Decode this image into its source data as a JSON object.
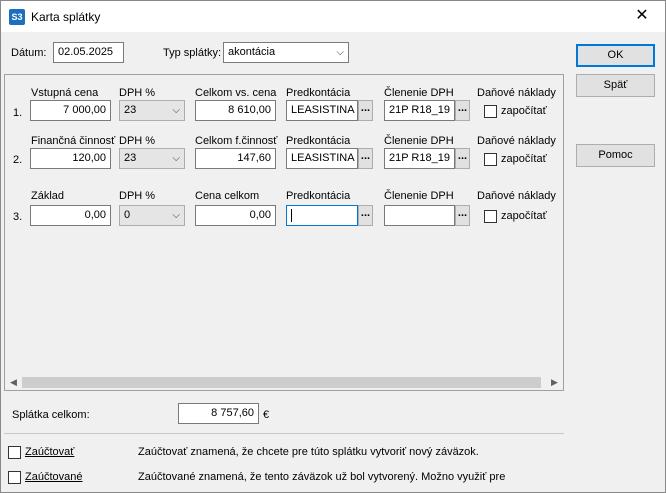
{
  "window": {
    "icon_text": "S3",
    "title": "Karta splátky",
    "close_glyph": "✕"
  },
  "header": {
    "datum_label": "Dátum:",
    "datum_value": "02.05.2025",
    "typ_label": "Typ splátky:",
    "typ_value": "akontácia"
  },
  "rows": [
    {
      "number": "1.",
      "amount_label": "Vstupná cena",
      "amount_value": "7 000,00",
      "dph_label": "DPH %",
      "dph_value": "23",
      "total_label": "Celkom vs. cena",
      "total_value": "8 610,00",
      "predkontacia_label": "Predkontácia",
      "predkontacia_value": "LEASISTINA",
      "clenenie_label": "Členenie DPH",
      "clenenie_value": "21P R18_19",
      "danove_label": "Daňové náklady",
      "zapocitat_label": "započítať"
    },
    {
      "number": "2.",
      "amount_label": "Finančná činnosť",
      "amount_value": "120,00",
      "dph_label": "DPH %",
      "dph_value": "23",
      "total_label": "Celkom f.činnosť",
      "total_value": "147,60",
      "predkontacia_label": "Predkontácia",
      "predkontacia_value": "LEASISTINA",
      "clenenie_label": "Členenie DPH",
      "clenenie_value": "21P R18_19",
      "danove_label": "Daňové náklady",
      "zapocitat_label": "započítať"
    },
    {
      "number": "3.",
      "amount_label": "Základ",
      "amount_value": "0,00",
      "dph_label": "DPH %",
      "dph_value": "0",
      "total_label": "Cena celkom",
      "total_value": "0,00",
      "predkontacia_label": "Predkontácia",
      "predkontacia_value": "",
      "clenenie_label": "Členenie DPH",
      "clenenie_value": "",
      "danove_label": "Daňové náklady",
      "zapocitat_label": "započítať"
    }
  ],
  "ellipsis": "...",
  "chevron": "⌵",
  "summary": {
    "label": "Splátka celkom:",
    "value": "8 757,60",
    "currency": "€"
  },
  "options": [
    {
      "label": "Zaúčtovať",
      "description": "Zaúčtovať znamená, že chcete pre túto splátku vytvoriť nový záväzok."
    },
    {
      "label": "Zaúčtované",
      "description": "Zaúčtované znamená, že tento záväzok už bol vytvorený. Možno využiť pre"
    }
  ],
  "buttons": {
    "ok": "OK",
    "back": "Späť",
    "help": "Pomoc"
  },
  "colors": {
    "accent": "#0078d7",
    "app_icon": "#1c6fbf"
  }
}
